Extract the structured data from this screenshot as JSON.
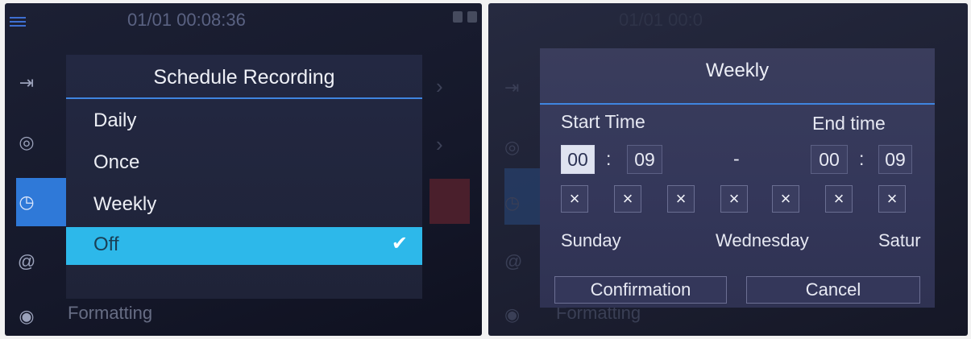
{
  "left": {
    "datetime": "01/01 00:08:36",
    "sidebar_icons": [
      "input-icon",
      "storage-icon",
      "clock-icon",
      "at-icon",
      "format-icon"
    ],
    "formatting_label": "Formatting",
    "modal": {
      "title": "Schedule Recording",
      "options": [
        "Daily",
        "Once",
        "Weekly",
        "Off"
      ],
      "selected": "Off"
    }
  },
  "right": {
    "datetime": "01/01 00:0",
    "formatting_label": "Formatting",
    "modal": {
      "title": "Weekly",
      "start_label": "Start Time",
      "end_label": "End time",
      "start_hour": "00",
      "start_min": "09",
      "end_hour": "00",
      "end_min": "09",
      "colon": ":",
      "dash": "-",
      "day_marks": [
        "×",
        "×",
        "×",
        "×",
        "×",
        "×",
        "×"
      ],
      "day_labels": [
        "Sunday",
        "Wednesday",
        "Satur"
      ],
      "confirm_label": "Confirmation",
      "cancel_label": "Cancel"
    }
  },
  "colors": {
    "accent_blue": "#3f85e0",
    "selection_cyan": "#2db8ea",
    "active_sidebar": "#2f79d8"
  }
}
